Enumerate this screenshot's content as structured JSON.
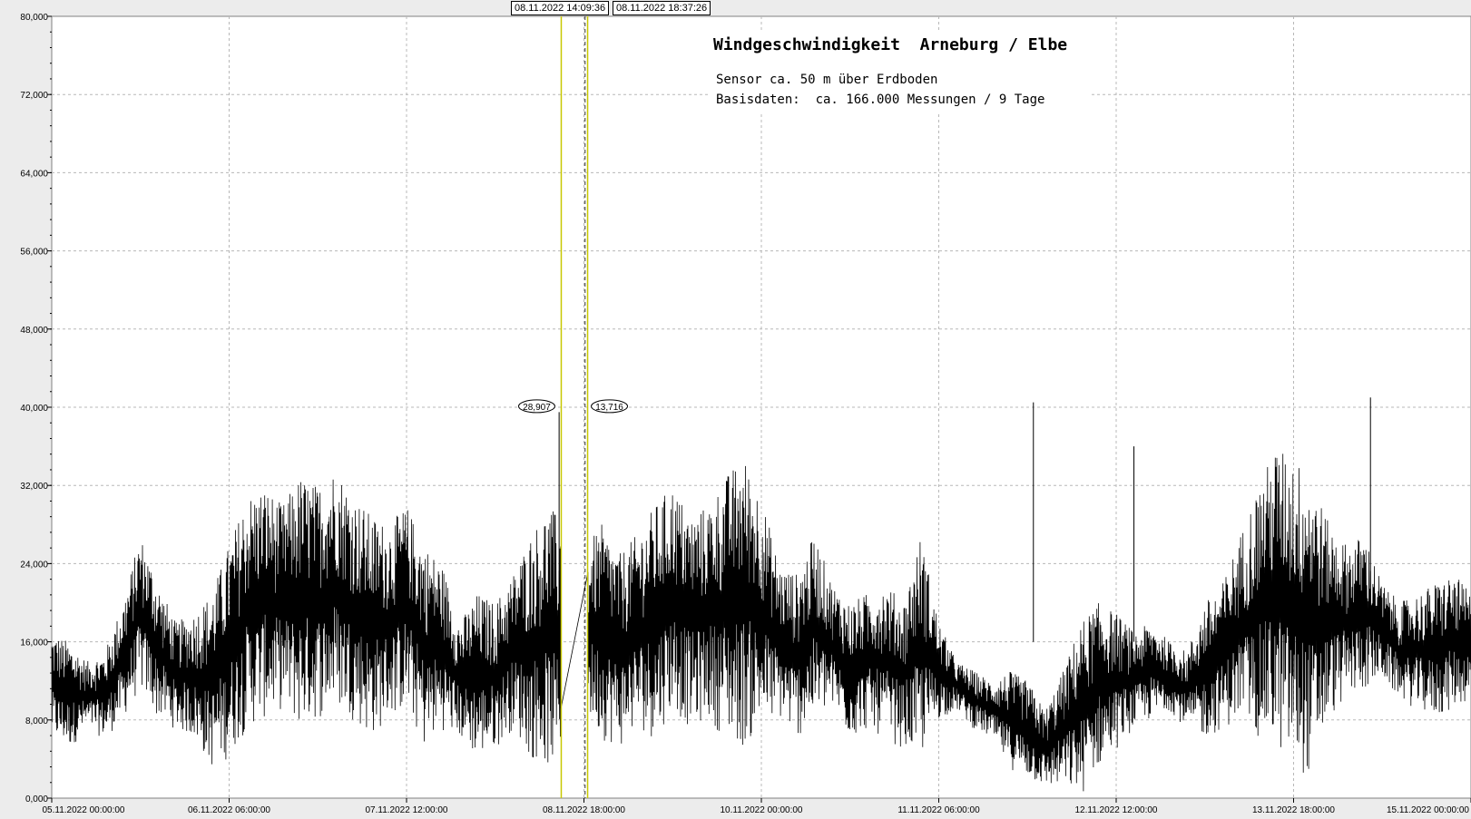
{
  "chart_data": {
    "type": "line",
    "title": "Windgeschwindigkeit  Arneburg / Elbe",
    "subtitle_lines": [
      "Sensor ca. 50 m über Erdboden",
      "Basisdaten:  ca. 166.000 Messungen / 9 Tage"
    ],
    "xlabel": "",
    "ylabel": "",
    "ylim": [
      0,
      80
    ],
    "xlim": [
      "05.11.2022 00:00:00",
      "15.11.2022 00:00:00"
    ],
    "y_ticks": [
      "0,000",
      "8,000",
      "16,000",
      "24,000",
      "32,000",
      "40,000",
      "48,000",
      "56,000",
      "64,000",
      "72,000",
      "80,000"
    ],
    "x_ticks": [
      "05.11.2022  00:00:00",
      "06.11.2022  06:00:00",
      "07.11.2022  12:00:00",
      "08.11.2022  18:00:00",
      "10.11.2022  00:00:00",
      "11.11.2022  06:00:00",
      "12.11.2022  12:00:00",
      "13.11.2022  18:00:00",
      "15.11.2022  00:00:00"
    ],
    "grid": true,
    "cursors": [
      {
        "label": "08.11.2022  14:09:36",
        "value_label": "28,907",
        "color": "#c8c800"
      },
      {
        "label": "08.11.2022  18:37:26",
        "value_label": "13,716",
        "color": "#c8c800"
      }
    ],
    "series": [
      {
        "description_envelope_points": "hour offsets from 05.11.2022 00:00 with min/max wind speed",
        "hours": [
          0,
          3,
          6,
          9,
          12,
          15,
          18,
          21,
          24,
          27,
          30,
          33,
          36,
          39,
          42,
          45,
          48,
          51,
          54,
          57,
          60,
          63,
          66,
          69,
          72,
          75,
          78,
          81,
          84,
          85.5,
          87,
          90.6,
          93,
          96,
          99,
          102,
          105,
          108,
          111,
          114,
          117,
          120,
          123,
          126,
          129,
          132,
          135,
          138,
          141,
          144,
          147,
          150,
          153,
          156,
          159,
          162,
          165,
          168,
          171,
          174,
          177,
          180,
          183,
          186,
          189,
          192,
          195,
          198,
          201,
          204,
          207,
          210,
          213,
          216,
          219,
          222,
          225,
          228,
          231,
          234,
          237,
          240
        ],
        "min": [
          6,
          5,
          7,
          6,
          8,
          11,
          8,
          7,
          6,
          3,
          4,
          7,
          8,
          9,
          7,
          8,
          9,
          8,
          6,
          8,
          9,
          5,
          7,
          6,
          4,
          5,
          7,
          4,
          3,
          3,
          8,
          8,
          6,
          5,
          7,
          6,
          9,
          7,
          8,
          6,
          5,
          7,
          8,
          6,
          8,
          9,
          6,
          7,
          6,
          5,
          4,
          8,
          9,
          7,
          6,
          3,
          2,
          1,
          1,
          0,
          3,
          5,
          7,
          8,
          9,
          7,
          6,
          7,
          8,
          6,
          5,
          3,
          2,
          8,
          10,
          11,
          12,
          10,
          9,
          8,
          9,
          10,
          9,
          8
        ],
        "max": [
          17,
          16,
          14,
          15,
          20,
          27,
          22,
          18,
          19,
          21,
          26,
          31,
          32,
          30,
          33,
          32,
          34,
          31,
          29,
          28,
          30,
          26,
          24,
          18,
          21,
          20,
          23,
          27,
          30,
          29,
          28,
          26,
          28,
          25,
          27,
          30,
          32,
          29,
          30,
          33,
          35,
          31,
          24,
          23,
          27,
          22,
          20,
          21,
          22,
          20,
          27,
          18,
          14,
          13,
          12,
          13,
          12,
          9,
          13,
          18,
          20,
          19,
          17,
          18,
          16,
          15,
          20,
          22,
          27,
          32,
          36,
          35,
          33,
          28,
          26,
          27,
          22,
          20,
          21,
          22,
          23,
          21,
          20,
          19
        ]
      }
    ]
  }
}
